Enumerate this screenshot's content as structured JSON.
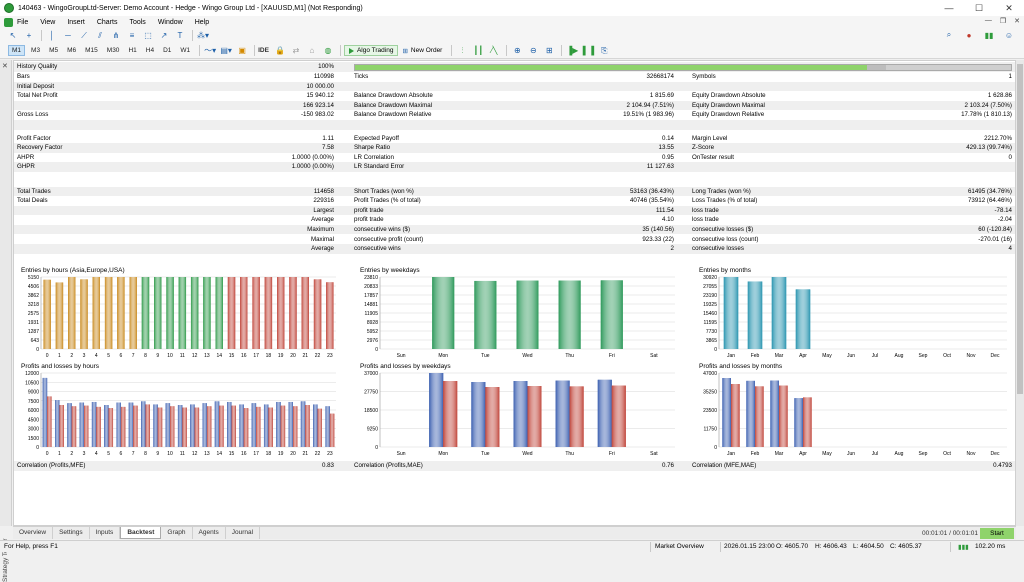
{
  "titlebar": {
    "title": "140463 - WingoGroupLtd-Server: Demo Account - Hedge - Wingo Group Ltd - [XAUUSD,M1] (Not Responding)",
    "min": "—",
    "max": "☐",
    "close": "✕"
  },
  "menu": [
    "File",
    "View",
    "Insert",
    "Charts",
    "Tools",
    "Window",
    "Help"
  ],
  "timeframes": [
    "M1",
    "M3",
    "M5",
    "M15",
    "M30",
    "H1",
    "H4",
    "D1",
    "W1"
  ],
  "timeframes_extra": [
    "M1",
    "M3",
    "M5",
    "M6",
    "M15",
    "M30",
    "H1",
    "H4",
    "D1",
    "W1"
  ],
  "toolbar": {
    "ide": "IDE",
    "algo_trading": "Algo Trading",
    "new_order": "New Order"
  },
  "stats": {
    "history_quality": {
      "label": "History Quality",
      "value": "100%"
    },
    "rows": [
      {
        "l1": "Bars",
        "v1": "110998",
        "l2": "Ticks",
        "v2": "32668174",
        "l3": "Symbols",
        "v3": "1"
      },
      {
        "l1": "Initial Deposit",
        "v1": "10 000.00",
        "l2": "",
        "v2": "",
        "l3": "",
        "v3": ""
      },
      {
        "l1": "Total Net Profit",
        "v1": "15 940.12",
        "l2": "Balance Drawdown Absolute",
        "v2": "1 815.69",
        "l3": "Equity Drawdown Absolute",
        "v3": "1 628.86"
      },
      {
        "l1": "",
        "v1": "166 923.14",
        "l2": "Balance Drawdown Maximal",
        "v2": "2 104.94 (7.51%)",
        "l3": "Equity Drawdown Maximal",
        "v3": "2 103.24 (7.50%)"
      },
      {
        "l1": "Gross Loss",
        "v1": "-150 983.02",
        "l2": "Balance Drawdown Relative",
        "v2": "19.51% (1 983.96)",
        "l3": "Equity Drawdown Relative",
        "v3": "17.78% (1 810.13)"
      },
      {
        "l1": "",
        "v1": "",
        "l2": "",
        "v2": "",
        "l3": "",
        "v3": ""
      },
      {
        "l1": "Profit Factor",
        "v1": "1.11",
        "l2": "Expected Payoff",
        "v2": "0.14",
        "l3": "Margin Level",
        "v3": "2212.70%"
      },
      {
        "l1": "Recovery Factor",
        "v1": "7.58",
        "l2": "Sharpe Ratio",
        "v2": "13.55",
        "l3": "Z-Score",
        "v3": "429.13 (99.74%)"
      },
      {
        "l1": "AHPR",
        "v1": "1.0000 (0.00%)",
        "l2": "LR Correlation",
        "v2": "0.95",
        "l3": "OnTester result",
        "v3": "0"
      },
      {
        "l1": "GHPR",
        "v1": "1.0000 (0.00%)",
        "l2": "LR Standard Error",
        "v2": "11 127.63",
        "l3": "",
        "v3": ""
      },
      {
        "l1": "",
        "v1": "",
        "l2": "",
        "v2": "",
        "l3": "",
        "v3": ""
      },
      {
        "l1": "Total Trades",
        "v1": "114658",
        "l2": "Short Trades (won %)",
        "v2": "53163 (36.43%)",
        "l3": "Long Trades (won %)",
        "v3": "61495 (34.76%)"
      },
      {
        "l1": "Total Deals",
        "v1": "229316",
        "l2": "Profit Trades (% of total)",
        "v2": "40746 (35.54%)",
        "l3": "Loss Trades (% of total)",
        "v3": "73912 (64.46%)"
      },
      {
        "l1": "",
        "v1": "Largest",
        "l2": "profit trade",
        "v2": "111.54",
        "l3": "loss trade",
        "v3": "-78.14"
      },
      {
        "l1": "",
        "v1": "Average",
        "l2": "profit trade",
        "v2": "4.10",
        "l3": "loss trade",
        "v3": "-2.04"
      },
      {
        "l1": "",
        "v1": "Maximum",
        "l2": "consecutive wins ($)",
        "v2": "35 (140.56)",
        "l3": "consecutive losses ($)",
        "v3": "60 (-120.84)"
      },
      {
        "l1": "",
        "v1": "Maximal",
        "l2": "consecutive profit (count)",
        "v2": "923.33 (22)",
        "l3": "consecutive loss (count)",
        "v3": "-270.01 (16)"
      },
      {
        "l1": "",
        "v1": "Average",
        "l2": "consecutive wins",
        "v2": "2",
        "l3": "consecutive losses",
        "v3": "4"
      }
    ],
    "correlations": [
      {
        "label": "Correlation (Profits,MFE)",
        "value": "0.83"
      },
      {
        "label": "Correlation (Profits,MAE)",
        "value": "0.76"
      },
      {
        "label": "Correlation (MFE,MAE)",
        "value": "0.4793"
      }
    ]
  },
  "chart_data": [
    {
      "type": "bar",
      "title": "Entries by hours (Asia,Europe,USA)",
      "categories": [
        "0",
        "1",
        "2",
        "3",
        "4",
        "5",
        "6",
        "7",
        "8",
        "9",
        "10",
        "11",
        "12",
        "13",
        "14",
        "15",
        "16",
        "17",
        "18",
        "19",
        "20",
        "21",
        "22",
        "23"
      ],
      "values": [
        4950,
        4760,
        5150,
        4980,
        5150,
        5150,
        5150,
        5150,
        5150,
        5150,
        5150,
        5150,
        5150,
        5150,
        5150,
        5150,
        5150,
        5150,
        5150,
        5150,
        5150,
        5150,
        4980,
        4770
      ],
      "yticks": [
        "5150",
        "4506",
        "3862",
        "3218",
        "2575",
        "1931",
        "1287",
        "643",
        "0"
      ],
      "ylim": [
        0,
        5150
      ],
      "colors": [
        "#c98a1e",
        "#c98a1e",
        "#c98a1e",
        "#c98a1e",
        "#c98a1e",
        "#c98a1e",
        "#c98a1e",
        "#c98a1e",
        "#2f9a4a",
        "#2f9a4a",
        "#2f9a4a",
        "#2f9a4a",
        "#2f9a4a",
        "#2f9a4a",
        "#2f9a4a",
        "#c0453a",
        "#c0453a",
        "#c0453a",
        "#c0453a",
        "#c0453a",
        "#c0453a",
        "#c0453a",
        "#c0453a",
        "#c0453a"
      ]
    },
    {
      "type": "bar",
      "title": "Entries by weekdays",
      "categories": [
        "Sun",
        "Mon",
        "Tue",
        "Wed",
        "Thu",
        "Fri",
        "Sat"
      ],
      "values": [
        0,
        23810,
        22500,
        22600,
        22650,
        22700,
        0
      ],
      "yticks": [
        "23810",
        "20833",
        "17857",
        "14881",
        "11905",
        "8928",
        "5952",
        "2976",
        "0"
      ],
      "ylim": [
        0,
        23810
      ],
      "colors": [
        "#2f9a5c"
      ]
    },
    {
      "type": "bar",
      "title": "Entries by months",
      "categories": [
        "Jan",
        "Feb",
        "Mar",
        "Apr",
        "May",
        "Jun",
        "Jul",
        "Aug",
        "Sep",
        "Oct",
        "Nov",
        "Dec"
      ],
      "values": [
        30920,
        29000,
        30920,
        25600,
        0,
        0,
        0,
        0,
        0,
        0,
        0,
        0
      ],
      "yticks": [
        "30920",
        "27055",
        "23190",
        "19325",
        "15460",
        "11595",
        "7730",
        "3865",
        "0"
      ],
      "ylim": [
        0,
        30920
      ],
      "colors": [
        "#2a95b0"
      ]
    },
    {
      "type": "bar",
      "title": "Profits and losses by hours",
      "categories": [
        "0",
        "1",
        "2",
        "3",
        "4",
        "5",
        "6",
        "7",
        "8",
        "9",
        "10",
        "11",
        "12",
        "13",
        "14",
        "15",
        "16",
        "17",
        "18",
        "19",
        "20",
        "21",
        "22",
        "23"
      ],
      "series": [
        {
          "name": "profits",
          "values": [
            11200,
            7600,
            7100,
            7200,
            7300,
            6800,
            7200,
            7200,
            7400,
            6900,
            7100,
            6800,
            6900,
            7100,
            7400,
            7300,
            6900,
            7100,
            6900,
            7300,
            7300,
            7400,
            6900,
            6600
          ]
        },
        {
          "name": "losses",
          "values": [
            8200,
            6800,
            6600,
            6700,
            6500,
            6300,
            6500,
            6700,
            6900,
            6400,
            6600,
            6400,
            6400,
            6600,
            6700,
            6700,
            6300,
            6500,
            6400,
            6700,
            6600,
            6800,
            6200,
            5400
          ]
        }
      ],
      "yticks": [
        "12000",
        "10500",
        "9000",
        "7500",
        "6000",
        "4500",
        "3000",
        "1500",
        "0"
      ],
      "ylim": [
        0,
        12000
      ],
      "colors": [
        "#3b5fb0",
        "#c0453a"
      ]
    },
    {
      "type": "bar",
      "title": "Profits and losses by weekdays",
      "categories": [
        "Sun",
        "Mon",
        "Tue",
        "Wed",
        "Thu",
        "Fri",
        "Sat"
      ],
      "series": [
        {
          "name": "profits",
          "values": [
            0,
            37000,
            32500,
            33000,
            33200,
            33600,
            0
          ]
        },
        {
          "name": "losses",
          "values": [
            0,
            33000,
            30000,
            30500,
            30300,
            30700,
            0
          ]
        }
      ],
      "yticks": [
        "37000",
        "27750",
        "18500",
        "9250",
        "0"
      ],
      "ylim": [
        0,
        37000
      ],
      "colors": [
        "#3b5fb0",
        "#c0453a"
      ]
    },
    {
      "type": "bar",
      "title": "Profits and losses by months",
      "categories": [
        "Jan",
        "Feb",
        "Mar",
        "Apr",
        "May",
        "Jun",
        "Jul",
        "Aug",
        "Sep",
        "Oct",
        "Nov",
        "Dec"
      ],
      "series": [
        {
          "name": "profits",
          "values": [
            43800,
            42000,
            42200,
            31000,
            0,
            0,
            0,
            0,
            0,
            0,
            0,
            0
          ]
        },
        {
          "name": "losses",
          "values": [
            40000,
            38500,
            39000,
            31500,
            0,
            0,
            0,
            0,
            0,
            0,
            0,
            0
          ]
        }
      ],
      "yticks": [
        "47000",
        "35250",
        "23500",
        "11750",
        "0"
      ],
      "ylim": [
        0,
        47000
      ],
      "colors": [
        "#3b5fb0",
        "#c0453a"
      ]
    }
  ],
  "tabs": [
    "Overview",
    "Settings",
    "Inputs",
    "Backtest",
    "Graph",
    "Agents",
    "Journal"
  ],
  "active_tab": "Backtest",
  "progress_time": "00:01:01 / 00:01:01",
  "start_label": "Start",
  "sidebar_title": "Strategy Tester",
  "status": {
    "help": "For Help, press F1",
    "market": "Market Overview",
    "datetime": "2026.01.15 23:00",
    "open": "O: 4605.70",
    "high": "H: 4606.43",
    "low": "L: 4604.50",
    "close": "C: 4605.37",
    "net": "102.20 ms"
  }
}
